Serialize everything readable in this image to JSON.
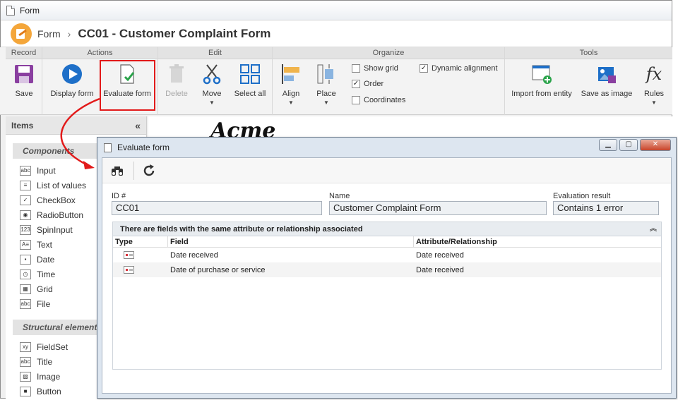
{
  "window": {
    "title": "Form"
  },
  "header": {
    "crumb": "Form",
    "separator": "›",
    "title": "CC01 - Customer Complaint Form"
  },
  "ribbon": {
    "groups": {
      "record": "Record",
      "actions": "Actions",
      "edit": "Edit",
      "organize": "Organize",
      "tools": "Tools"
    },
    "buttons": {
      "save": "Save",
      "display_form": "Display form",
      "evaluate_form": "Evaluate form",
      "delete": "Delete",
      "move": "Move",
      "select_all": "Select all",
      "align": "Align",
      "place": "Place",
      "import_from_entity": "Import from entity",
      "save_as_image": "Save as image",
      "rules": "Rules"
    },
    "checks": {
      "show_grid": {
        "label": "Show grid",
        "checked": false
      },
      "order": {
        "label": "Order",
        "checked": true
      },
      "coordinates": {
        "label": "Coordinates",
        "checked": false
      },
      "dynamic_alignment": {
        "label": "Dynamic alignment",
        "checked": true
      }
    }
  },
  "items_panel": {
    "title": "Items",
    "collapse": "«",
    "sections": {
      "components": "Components",
      "structural": "Structural element"
    },
    "components": [
      {
        "label": "Input",
        "icon": "abc"
      },
      {
        "label": "List of values",
        "icon": "≡"
      },
      {
        "label": "CheckBox",
        "icon": "✓"
      },
      {
        "label": "RadioButton",
        "icon": "◉"
      },
      {
        "label": "SpinInput",
        "icon": "123"
      },
      {
        "label": "Text",
        "icon": "A≡"
      },
      {
        "label": "Date",
        "icon": "▪"
      },
      {
        "label": "Time",
        "icon": "◷"
      },
      {
        "label": "Grid",
        "icon": "▦"
      },
      {
        "label": "File",
        "icon": "abc"
      }
    ],
    "structural": [
      {
        "label": "FieldSet",
        "icon": "xy"
      },
      {
        "label": "Title",
        "icon": "abc"
      },
      {
        "label": "Image",
        "icon": "▨"
      },
      {
        "label": "Button",
        "icon": "■"
      }
    ]
  },
  "canvas": {
    "logo_text": "Acme"
  },
  "dialog": {
    "title": "Evaluate form",
    "fields": {
      "id_label": "ID #",
      "id_value": "CC01",
      "name_label": "Name",
      "name_value": "Customer Complaint Form",
      "result_label": "Evaluation result",
      "result_value": "Contains 1 error"
    },
    "grid": {
      "title": "There are fields with the same attribute or relationship associated",
      "columns": [
        "Type",
        "Field",
        "Attribute/Relationship"
      ],
      "rows": [
        {
          "field": "Date received",
          "attribute": "Date received"
        },
        {
          "field": "Date of purchase or service",
          "attribute": "Date received"
        }
      ]
    }
  },
  "colors": {
    "highlight": "#e21a1a",
    "accent": "#f4a63a",
    "dialog_bg": "#dde6f0"
  }
}
